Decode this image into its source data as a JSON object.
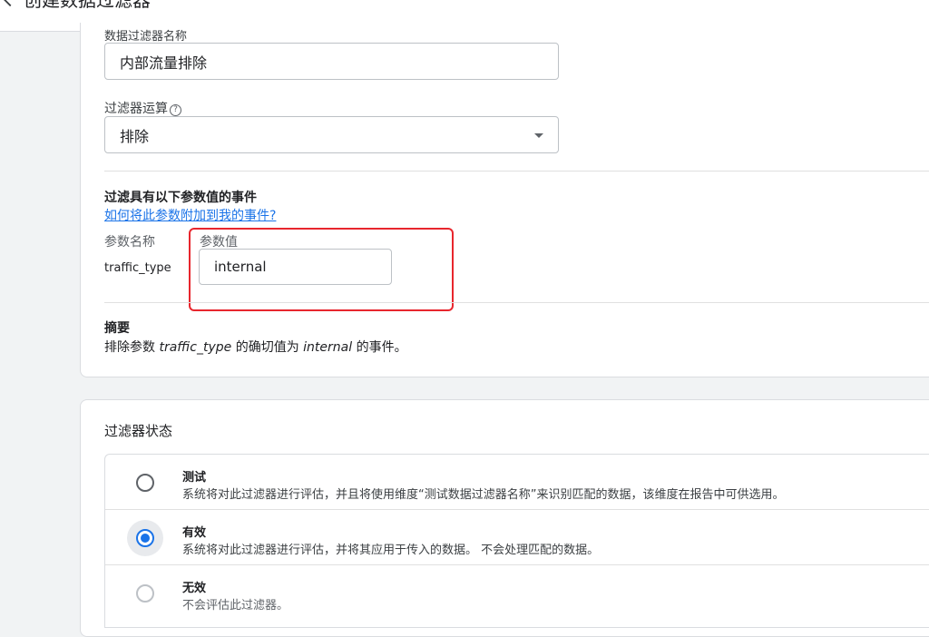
{
  "header": {
    "back_icon": "chevron-left-icon",
    "title": "创建数据过滤器"
  },
  "form": {
    "name_label": "数据过滤器名称",
    "name_value": "内部流量排除",
    "operation_label": "过滤器运算",
    "operation_help_icon": "help-circle-icon",
    "operation_value": "排除",
    "event_section_title": "过滤具有以下参数值的事件",
    "help_link": "如何将此参数附加到我的事件?",
    "param_name_header": "参数名称",
    "param_value_header": "参数值",
    "param_name": "traffic_type",
    "param_value": "internal",
    "highlight_color": "#e8262d"
  },
  "summary": {
    "title": "摘要",
    "prefix": "排除参数 ",
    "param": "traffic_type",
    "middle": " 的确切值为 ",
    "value": "internal",
    "suffix": " 的事件。"
  },
  "status": {
    "title": "过滤器状态",
    "options": [
      {
        "title": "测试",
        "desc": "系统将对此过滤器进行评估，并且将使用维度“测试数据过滤器名称”来识别匹配的数据，该维度在报告中可供选用。",
        "checked": false
      },
      {
        "title": "有效",
        "desc": "系统将对此过滤器进行评估，并将其应用于传入的数据。 不会处理匹配的数据。",
        "checked": true
      },
      {
        "title": "无效",
        "desc": "不会评估此过滤器。",
        "checked": false
      }
    ]
  },
  "colors": {
    "accent": "#1a73e8",
    "background": "#f1f3f4"
  }
}
